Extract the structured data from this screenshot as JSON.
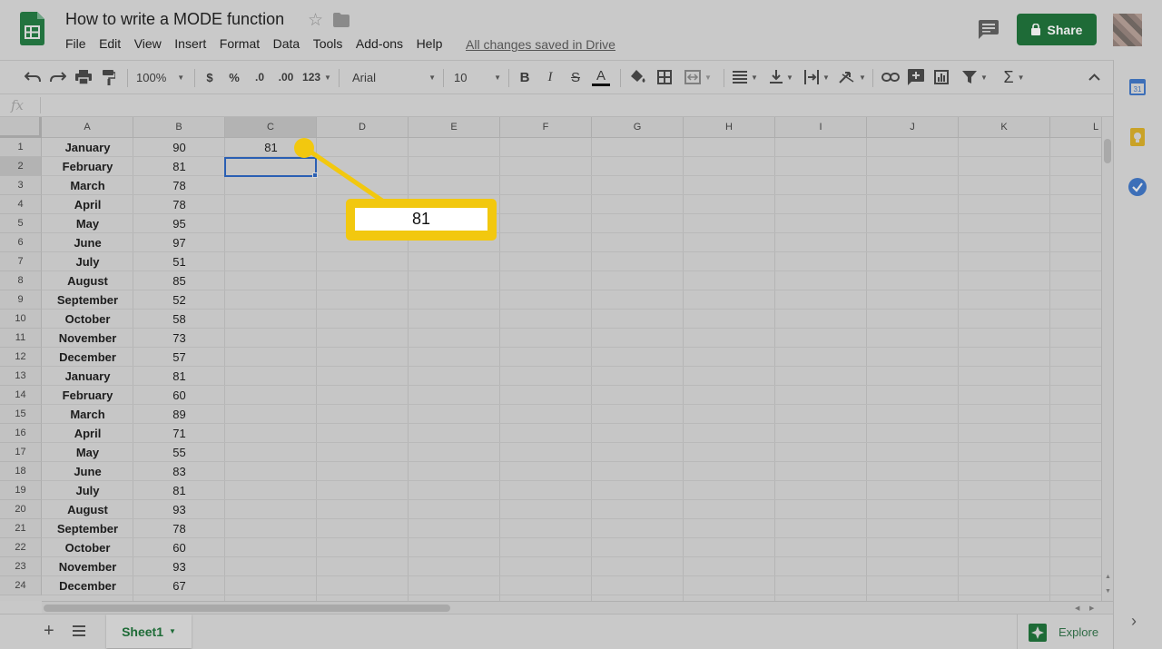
{
  "document": {
    "title": "How to write a MODE function",
    "save_status": "All changes saved in Drive",
    "share_label": "Share"
  },
  "menu": [
    "File",
    "Edit",
    "View",
    "Insert",
    "Format",
    "Data",
    "Tools",
    "Add-ons",
    "Help"
  ],
  "toolbar": {
    "zoom": "100%",
    "currency": "$",
    "percent": "%",
    "decrease_decimals": ".0",
    "increase_decimals": ".00",
    "more_formats": "123",
    "font": "Arial",
    "font_size": "10",
    "bold": "B",
    "italic": "I",
    "strikethrough": "S",
    "text_color_glyph": "A",
    "functions": "Σ"
  },
  "formula_bar": {
    "fx": "fx",
    "content": ""
  },
  "columns": [
    "A",
    "B",
    "C",
    "D",
    "E",
    "F",
    "G",
    "H",
    "I",
    "J",
    "K",
    "L"
  ],
  "rows": [
    {
      "num": "1",
      "a": "January",
      "b": "90",
      "c": "81"
    },
    {
      "num": "2",
      "a": "February",
      "b": "81",
      "c": ""
    },
    {
      "num": "3",
      "a": "March",
      "b": "78",
      "c": ""
    },
    {
      "num": "4",
      "a": "April",
      "b": "78",
      "c": ""
    },
    {
      "num": "5",
      "a": "May",
      "b": "95",
      "c": ""
    },
    {
      "num": "6",
      "a": "June",
      "b": "97",
      "c": ""
    },
    {
      "num": "7",
      "a": "July",
      "b": "51",
      "c": ""
    },
    {
      "num": "8",
      "a": "August",
      "b": "85",
      "c": ""
    },
    {
      "num": "9",
      "a": "September",
      "b": "52",
      "c": ""
    },
    {
      "num": "10",
      "a": "October",
      "b": "58",
      "c": ""
    },
    {
      "num": "11",
      "a": "November",
      "b": "73",
      "c": ""
    },
    {
      "num": "12",
      "a": "December",
      "b": "57",
      "c": ""
    },
    {
      "num": "13",
      "a": "January",
      "b": "81",
      "c": ""
    },
    {
      "num": "14",
      "a": "February",
      "b": "60",
      "c": ""
    },
    {
      "num": "15",
      "a": "March",
      "b": "89",
      "c": ""
    },
    {
      "num": "16",
      "a": "April",
      "b": "71",
      "c": ""
    },
    {
      "num": "17",
      "a": "May",
      "b": "55",
      "c": ""
    },
    {
      "num": "18",
      "a": "June",
      "b": "83",
      "c": ""
    },
    {
      "num": "19",
      "a": "July",
      "b": "81",
      "c": ""
    },
    {
      "num": "20",
      "a": "August",
      "b": "93",
      "c": ""
    },
    {
      "num": "21",
      "a": "September",
      "b": "78",
      "c": ""
    },
    {
      "num": "22",
      "a": "October",
      "b": "60",
      "c": ""
    },
    {
      "num": "23",
      "a": "November",
      "b": "93",
      "c": ""
    },
    {
      "num": "24",
      "a": "December",
      "b": "67",
      "c": ""
    }
  ],
  "selection": {
    "cell": "C2",
    "column": "C",
    "row": "2"
  },
  "callout": {
    "value": "81",
    "color": "#f2c80f"
  },
  "sheet_tabs": [
    {
      "label": "Sheet1",
      "active": true
    }
  ],
  "explore_label": "Explore",
  "colors": {
    "brand_green": "#1e6b37",
    "selection_blue": "#2a5fb3",
    "callout_yellow": "#f2c80f"
  }
}
